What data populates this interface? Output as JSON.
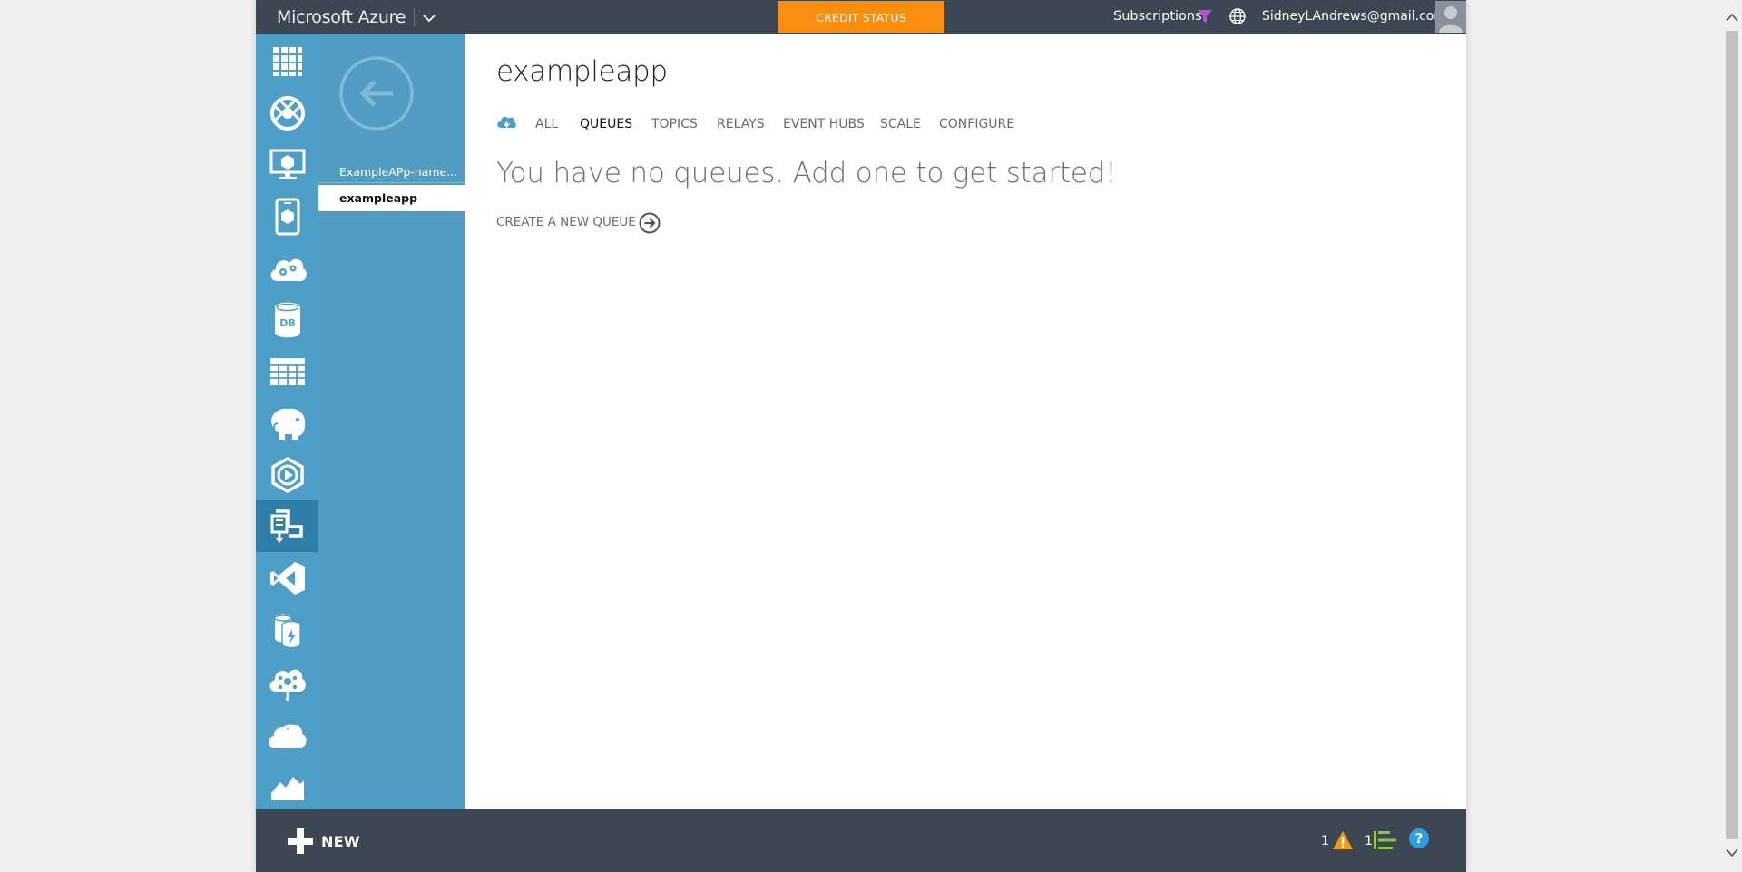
{
  "topbar": {
    "brand": "Microsoft Azure",
    "credit_status": "CREDIT STATUS",
    "subscriptions": "Subscriptions",
    "account": "SidneyLAndrews@gmail.com"
  },
  "nav": {
    "items": [
      {
        "icon": "all-items-grid-icon"
      },
      {
        "icon": "web-sites-icon"
      },
      {
        "icon": "virtual-machines-icon"
      },
      {
        "icon": "mobile-services-icon"
      },
      {
        "icon": "cloud-services-icon"
      },
      {
        "icon": "sql-databases-icon",
        "text": "DB"
      },
      {
        "icon": "storage-icon"
      },
      {
        "icon": "hdinsight-icon"
      },
      {
        "icon": "media-services-icon"
      },
      {
        "icon": "service-bus-icon",
        "selected": true
      },
      {
        "icon": "visual-studio-icon"
      },
      {
        "icon": "cache-icon"
      },
      {
        "icon": "biztalk-services-icon"
      },
      {
        "icon": "recovery-services-icon"
      },
      {
        "icon": "cdn-icon"
      }
    ]
  },
  "col2": {
    "parent": "ExampleAPp-name...",
    "current": "exampleapp"
  },
  "main": {
    "title": "exampleapp",
    "tabs": [
      {
        "label": "ALL",
        "active": false
      },
      {
        "label": "QUEUES",
        "active": true
      },
      {
        "label": "TOPICS",
        "active": false
      },
      {
        "label": "RELAYS",
        "active": false
      },
      {
        "label": "EVENT HUBS",
        "active": false
      },
      {
        "label": "SCALE",
        "active": false
      },
      {
        "label": "CONFIGURE",
        "active": false
      }
    ],
    "empty_message": "You have no queues. Add one to get started!",
    "create_link": "CREATE A NEW QUEUE"
  },
  "bottombar": {
    "new_label": "NEW",
    "alerts_count": "1",
    "operations_count": "1"
  },
  "colors": {
    "topbar": "#3d4753",
    "nav": "#4e9fc8",
    "nav_selected": "#2f7fa8",
    "col2": "#519dc2",
    "credit": "#fb8d10",
    "filter": "#b84fd6",
    "alert": "#f39c12",
    "operations": "#8cc63f",
    "help": "#2d9de0"
  }
}
